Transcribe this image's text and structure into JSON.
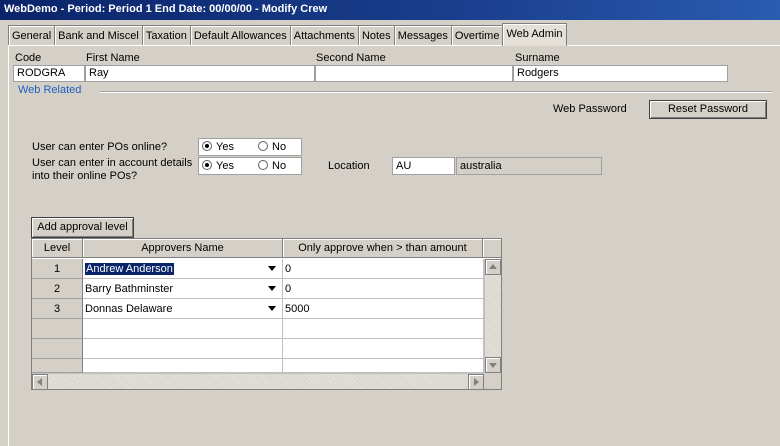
{
  "window": {
    "title": "WebDemo  - Period: Period 1  End Date: 00/00/00 - Modify Crew"
  },
  "tabs": [
    {
      "label": "General"
    },
    {
      "label": "Bank and Miscel"
    },
    {
      "label": "Taxation"
    },
    {
      "label": "Default Allowances"
    },
    {
      "label": "Attachments"
    },
    {
      "label": "Notes"
    },
    {
      "label": "Messages"
    },
    {
      "label": "Overtime"
    },
    {
      "label": "Web Admin",
      "active": true
    }
  ],
  "crew": {
    "code_label": "Code",
    "code_value": "RODGRA",
    "first_name_label": "First Name",
    "first_name_value": "Ray",
    "second_name_label": "Second Name",
    "second_name_value": "",
    "surname_label": "Surname",
    "surname_value": "Rodgers"
  },
  "web": {
    "section_title": "Web Related",
    "password_label": "Web Password",
    "reset_button": "Reset Password",
    "q1_label": "User can enter POs online?",
    "q1_yes": "Yes",
    "q1_no": "No",
    "q1_selected": "Yes",
    "q2_label_line1": "User can enter in account details",
    "q2_label_line2": "into their online POs?",
    "q2_yes": "Yes",
    "q2_no": "No",
    "q2_selected": "Yes",
    "location_label": "Location",
    "location_code": "AU",
    "location_name": "australia"
  },
  "approvals": {
    "add_button": "Add approval level",
    "headers": {
      "level": "Level",
      "approver": "Approvers Name",
      "amount": "Only approve when > than amount"
    },
    "rows": [
      {
        "level": "1",
        "approver": "Andrew Anderson",
        "amount": "0",
        "selected": true
      },
      {
        "level": "2",
        "approver": "Barry Bathminster",
        "amount": "0"
      },
      {
        "level": "3",
        "approver": "Donnas Delaware",
        "amount": "5000"
      }
    ]
  },
  "colors": {
    "titlebar": "#0a246a",
    "window_bg": "#d4d0c8",
    "section_title": "#1f5fbf",
    "selection": "#0a246a"
  }
}
